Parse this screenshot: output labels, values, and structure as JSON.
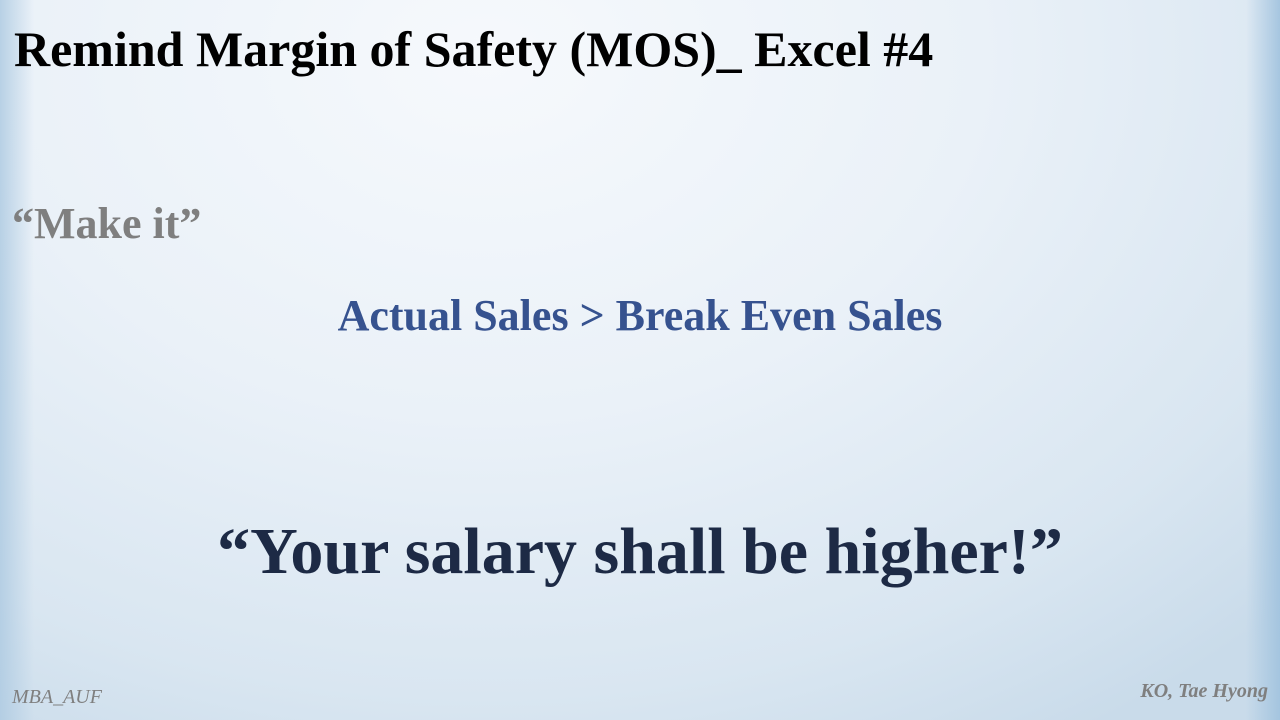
{
  "slide": {
    "title": "Remind Margin of Safety (MOS)_ Excel #4",
    "subheading": "“Make it”",
    "formula": "Actual Sales > Break Even Sales",
    "quote": "“Your salary shall be higher!”",
    "footer_left": "MBA_AUF",
    "footer_right": "KO, Tae Hyong"
  },
  "colors": {
    "title": "#000000",
    "subheading": "#7f7f7f",
    "formula": "#36528f",
    "quote": "#1d2a45",
    "footer": "#7f7f7f"
  }
}
